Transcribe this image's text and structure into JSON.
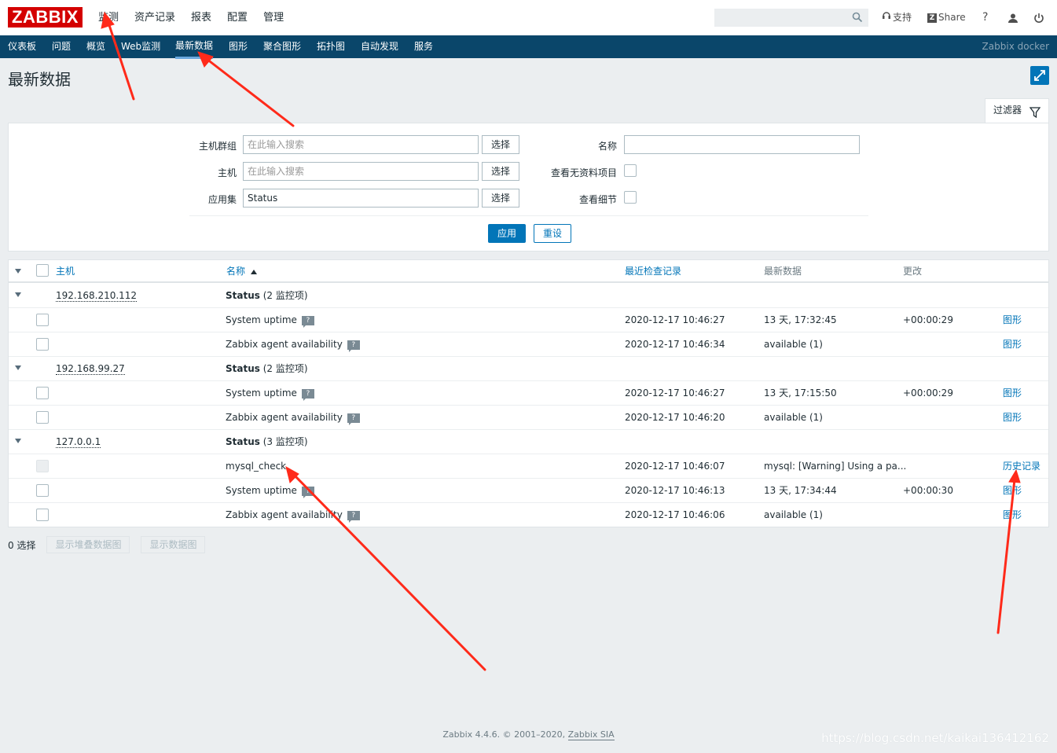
{
  "header": {
    "logo": "ZABBIX",
    "main_menu": [
      "监测",
      "资产记录",
      "报表",
      "配置",
      "管理"
    ],
    "search_placeholder": "",
    "support": "支持",
    "share": "Share",
    "help": "?"
  },
  "submenu": {
    "items": [
      "仪表板",
      "问题",
      "概览",
      "Web监测",
      "最新数据",
      "图形",
      "聚合图形",
      "拓扑图",
      "自动发现",
      "服务"
    ],
    "active": "最新数据",
    "server_name": "Zabbix docker"
  },
  "page_title": "最新数据",
  "filter": {
    "tab_label": "过滤器",
    "host_group_label": "主机群组",
    "host_group_placeholder": "在此输入搜索",
    "host_label": "主机",
    "host_placeholder": "在此输入搜索",
    "application_label": "应用集",
    "application_value": "Status",
    "select_label": "选择",
    "name_label": "名称",
    "name_value": "",
    "show_items_without_data_label": "查看无资料项目",
    "show_details_label": "查看细节",
    "apply_label": "应用",
    "reset_label": "重设"
  },
  "table": {
    "columns": {
      "host": "主机",
      "name": "名称",
      "last_check": "最近检查记录",
      "last_value": "最新数据",
      "change": "更改"
    },
    "groups": [
      {
        "host": "192.168.210.112",
        "app_name": "Status",
        "app_count": "(2 监控项)",
        "items": [
          {
            "name": "System uptime",
            "last_check": "2020-12-17 10:46:27",
            "last_value": "13 天, 17:32:45",
            "change": "+00:00:29",
            "action": "图形"
          },
          {
            "name": "Zabbix agent availability",
            "last_check": "2020-12-17 10:46:34",
            "last_value": "available (1)",
            "change": "",
            "action": "图形"
          }
        ]
      },
      {
        "host": "192.168.99.27",
        "app_name": "Status",
        "app_count": "(2 监控项)",
        "items": [
          {
            "name": "System uptime",
            "last_check": "2020-12-17 10:46:27",
            "last_value": "13 天, 17:15:50",
            "change": "+00:00:29",
            "action": "图形"
          },
          {
            "name": "Zabbix agent availability",
            "last_check": "2020-12-17 10:46:20",
            "last_value": "available (1)",
            "change": "",
            "action": "图形"
          }
        ]
      },
      {
        "host": "127.0.0.1",
        "app_name": "Status",
        "app_count": "(3 监控项)",
        "items": [
          {
            "name": "mysql_check",
            "last_check": "2020-12-17 10:46:07",
            "last_value": "mysql: [Warning] Using a pa...",
            "change": "",
            "action": "历史记录"
          },
          {
            "name": "System uptime",
            "last_check": "2020-12-17 10:46:13",
            "last_value": "13 天, 17:34:44",
            "change": "+00:00:30",
            "action": "图形"
          },
          {
            "name": "Zabbix agent availability",
            "last_check": "2020-12-17 10:46:06",
            "last_value": "available (1)",
            "change": "",
            "action": "图形"
          }
        ]
      }
    ]
  },
  "actions": {
    "selected_count": "0 选择",
    "stacked_graph": "显示堆叠数据图",
    "graph": "显示数据图"
  },
  "footer": {
    "version_text": "Zabbix 4.4.6. © 2001–2020, ",
    "company": "Zabbix SIA"
  },
  "watermark": "https://blog.csdn.net/kaikai136412162",
  "colors": {
    "brand_red": "#d40000",
    "nav_blue": "#0a466a",
    "link_blue": "#0275b8",
    "annotation_arrow": "#ff2a1a"
  }
}
